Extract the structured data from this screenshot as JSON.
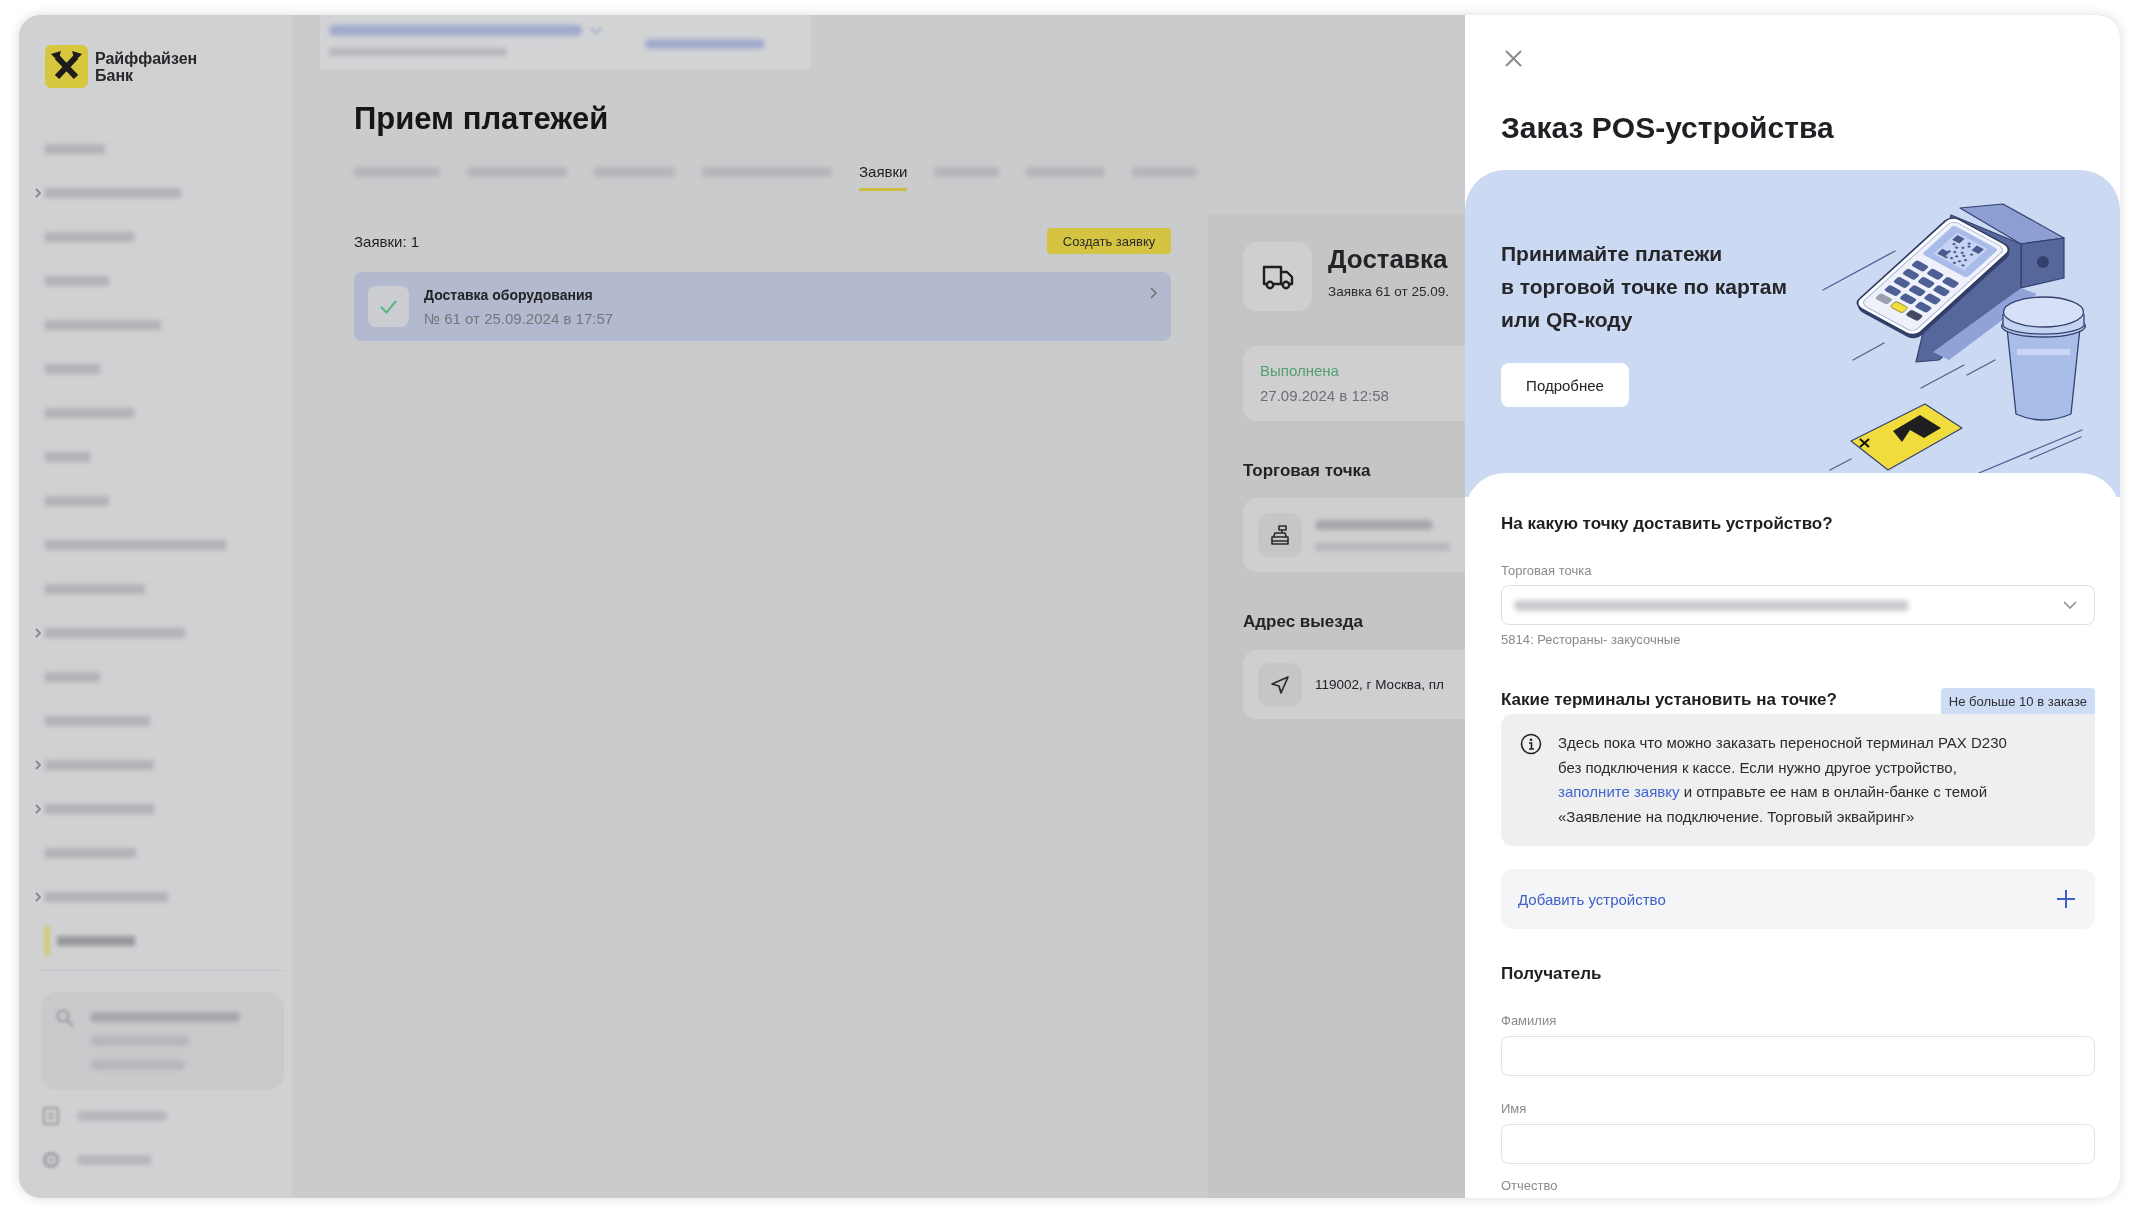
{
  "sidebar": {
    "logo_text": "Райффайзен Банк",
    "items": [
      {
        "selected": false,
        "expandable": false
      },
      {
        "selected": false,
        "expandable": true
      },
      {
        "selected": false,
        "expandable": false
      },
      {
        "selected": false,
        "expandable": false
      },
      {
        "selected": false,
        "expandable": false
      },
      {
        "selected": false,
        "expandable": false
      },
      {
        "selected": false,
        "expandable": false
      },
      {
        "selected": false,
        "expandable": false
      },
      {
        "selected": false,
        "expandable": false
      },
      {
        "selected": false,
        "expandable": false
      },
      {
        "selected": false,
        "expandable": false
      },
      {
        "selected": false,
        "expandable": true
      },
      {
        "selected": false,
        "expandable": false
      },
      {
        "selected": false,
        "expandable": false
      },
      {
        "selected": false,
        "expandable": true
      },
      {
        "selected": false,
        "expandable": true
      },
      {
        "selected": false,
        "expandable": false
      },
      {
        "selected": false,
        "expandable": true
      },
      {
        "selected": true,
        "expandable": false
      }
    ]
  },
  "page": {
    "title": "Прием платежей",
    "tabs": [
      {
        "selected": false
      },
      {
        "selected": false
      },
      {
        "selected": false
      },
      {
        "selected": false
      },
      {
        "label": "Заявки",
        "selected": true
      },
      {
        "selected": false
      },
      {
        "selected": false
      },
      {
        "selected": false
      }
    ]
  },
  "requests": {
    "count": "Заявки: 1",
    "create_button": "Создать заявку",
    "items": [
      {
        "title": "Доставка оборудования",
        "subtitle": "№ 61 от 25.09.2024 в 17:57",
        "completed": true,
        "selected": true
      }
    ]
  },
  "detail": {
    "title": "Доставка",
    "subtitle": "Заявка 61 от 25.09.",
    "status": {
      "kind": "done",
      "label": "Выполнена",
      "date": "27.09.2024 в 12:58"
    },
    "sections": [
      {
        "heading": "Торговая точка",
        "kind": "outlet"
      },
      {
        "heading": "Адрес выезда",
        "kind": "address",
        "text": "119002, г Москва, пл"
      }
    ]
  },
  "drawer": {
    "title": "Заказ POS-устройства",
    "promo": {
      "text_lines": [
        "Принимайте платежи",
        "в торговой точке по картам",
        "или QR-коду"
      ],
      "button": "Подробнее"
    },
    "delivery": {
      "heading": "На какую точку доставить устройство?",
      "field_label": "Торговая точка",
      "hint": "5814: Рестораны- закусочные"
    },
    "terminals": {
      "heading": "Какие терминалы установить на точке?",
      "badge": "Не больше 10 в заказе",
      "info_before": "Здесь пока что можно заказать переносной терминал PAX D230 без подключения к кассе. Если нужно другое устройство, ",
      "info_link": "заполните заявку",
      "info_after": " и отправьте ее нам в онлайн-банке с темой «Заявление на подключение. Торговый эквайринг»",
      "add_button": "Добавить устройство"
    },
    "recipient": {
      "heading": "Получатель",
      "fields": [
        {
          "label": "Фамилия"
        },
        {
          "label": "Имя"
        }
      ],
      "partial_label": "Отчество"
    }
  }
}
